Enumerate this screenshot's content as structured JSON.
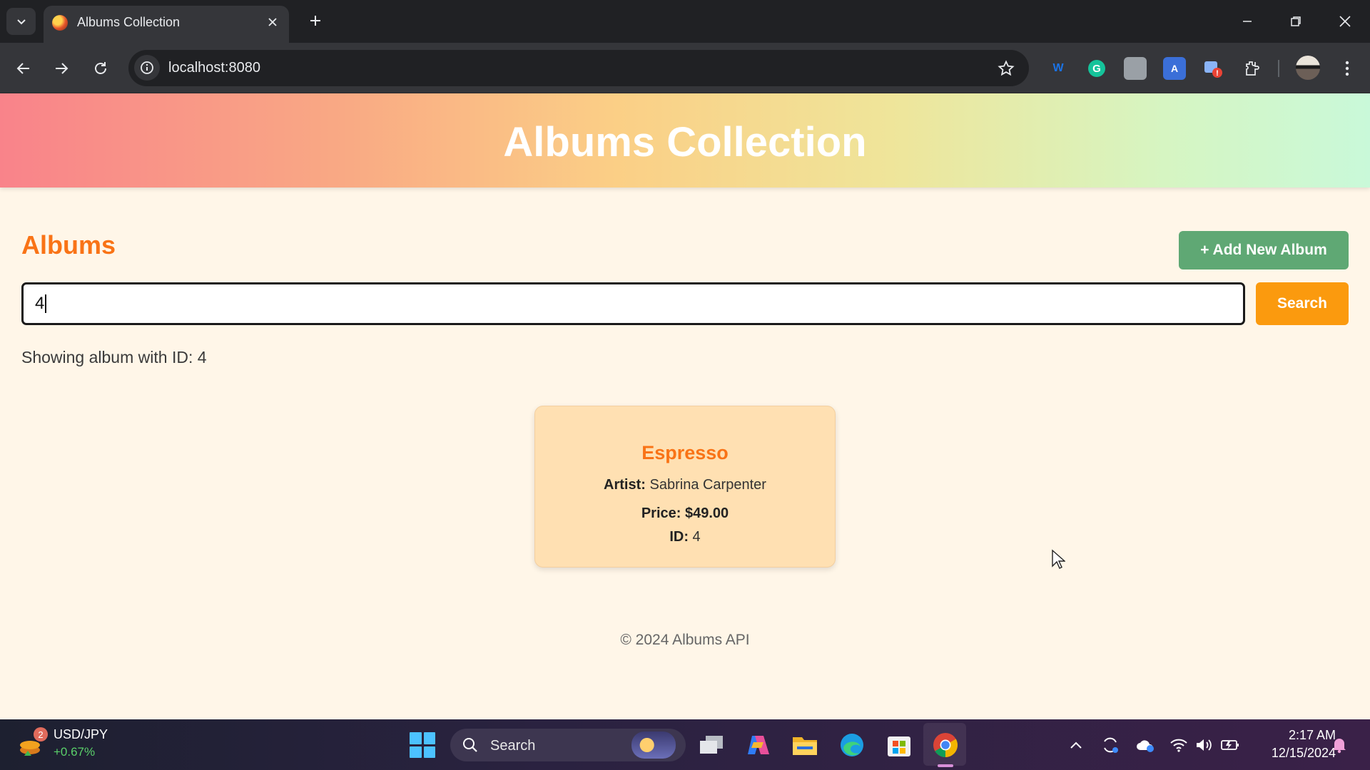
{
  "browser": {
    "tab_title": "Albums Collection",
    "url": "localhost:8080"
  },
  "page": {
    "banner_title": "Albums Collection",
    "section_heading": "Albums",
    "add_button_label": "+ Add New Album",
    "search": {
      "value": "4",
      "button_label": "Search"
    },
    "status_text": "Showing album with ID: 4",
    "album": {
      "title": "Espresso",
      "artist_label": "Artist:",
      "artist": "Sabrina Carpenter",
      "price_label": "Price:",
      "price": "$49.00",
      "id_label": "ID:",
      "id": "4"
    },
    "footer": "© 2024 Albums API"
  },
  "taskbar": {
    "widget": {
      "badge": "2",
      "name": "USD/JPY",
      "value": "+0.67%"
    },
    "search_placeholder": "Search",
    "clock_time": "2:17 AM",
    "clock_date": "12/15/2024"
  },
  "colors": {
    "accent_orange": "#f97316",
    "add_button": "#5fa874",
    "search_button": "#fb9a0e",
    "card_bg": "#ffe0b2",
    "page_bg": "#fff6e8"
  },
  "icons": [
    "tab-list-icon",
    "close-icon",
    "plus-icon",
    "minimize-icon",
    "restore-icon",
    "back-arrow-icon",
    "forward-arrow-icon",
    "reload-icon",
    "site-info-icon",
    "bookmark-star-icon",
    "extensions-icon",
    "menu-dots-icon",
    "windows-start-icon",
    "search-icon",
    "wifi-icon",
    "volume-icon",
    "battery-icon",
    "bell-icon"
  ]
}
